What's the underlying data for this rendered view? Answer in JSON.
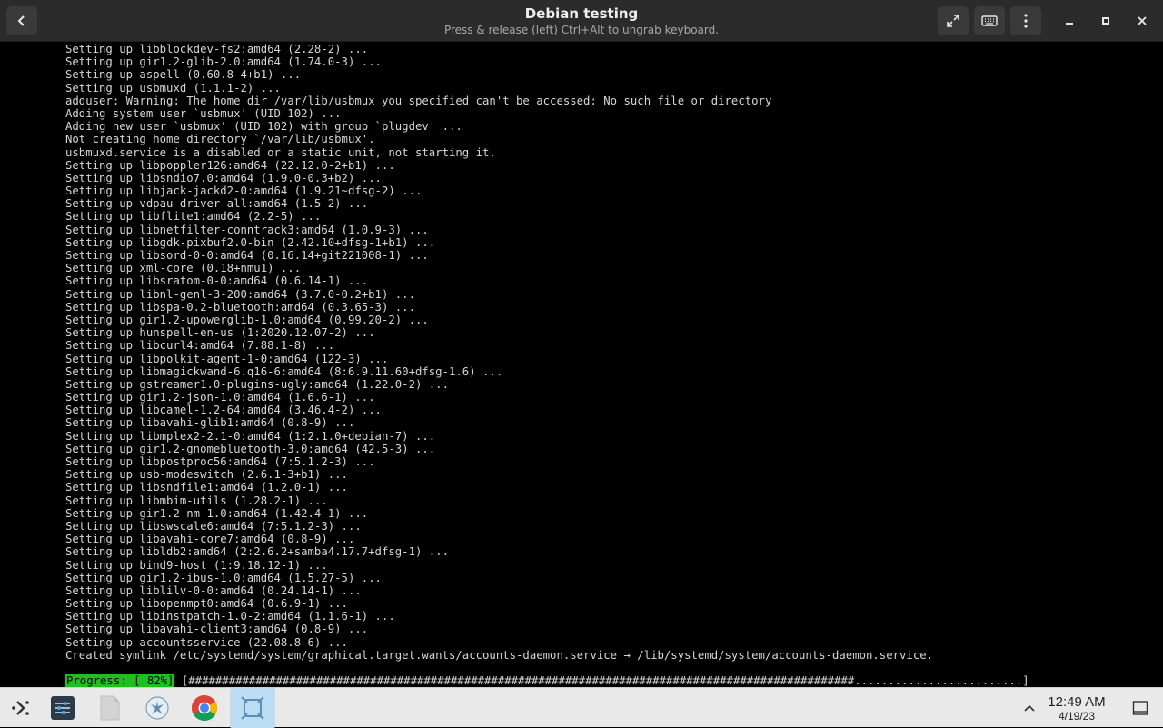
{
  "window": {
    "title": "Debian testing",
    "subtitle": "Press & release (left) Ctrl+Alt to ungrab keyboard."
  },
  "icons": {
    "back": "back-arrow-icon",
    "fullscreen": "fullscreen-icon",
    "keyboard": "keyboard-icon",
    "menu": "kebab-menu-icon",
    "minimize": "minimize-icon",
    "maximize": "maximize-icon",
    "close": "close-icon"
  },
  "terminal": {
    "lines": [
      "Setting up libblockdev-fs2:amd64 (2.28-2) ...",
      "Setting up gir1.2-glib-2.0:amd64 (1.74.0-3) ...",
      "Setting up aspell (0.60.8-4+b1) ...",
      "Setting up usbmuxd (1.1.1-2) ...",
      "adduser: Warning: The home dir /var/lib/usbmux you specified can't be accessed: No such file or directory",
      "Adding system user `usbmux' (UID 102) ...",
      "Adding new user `usbmux' (UID 102) with group `plugdev' ...",
      "Not creating home directory `/var/lib/usbmux'.",
      "usbmuxd.service is a disabled or a static unit, not starting it.",
      "Setting up libpoppler126:amd64 (22.12.0-2+b1) ...",
      "Setting up libsndio7.0:amd64 (1.9.0-0.3+b2) ...",
      "Setting up libjack-jackd2-0:amd64 (1.9.21~dfsg-2) ...",
      "Setting up vdpau-driver-all:amd64 (1.5-2) ...",
      "Setting up libflite1:amd64 (2.2-5) ...",
      "Setting up libnetfilter-conntrack3:amd64 (1.0.9-3) ...",
      "Setting up libgdk-pixbuf2.0-bin (2.42.10+dfsg-1+b1) ...",
      "Setting up libsord-0-0:amd64 (0.16.14+git221008-1) ...",
      "Setting up xml-core (0.18+nmu1) ...",
      "Setting up libsratom-0-0:amd64 (0.6.14-1) ...",
      "Setting up libnl-genl-3-200:amd64 (3.7.0-0.2+b1) ...",
      "Setting up libspa-0.2-bluetooth:amd64 (0.3.65-3) ...",
      "Setting up gir1.2-upowerglib-1.0:amd64 (0.99.20-2) ...",
      "Setting up hunspell-en-us (1:2020.12.07-2) ...",
      "Setting up libcurl4:amd64 (7.88.1-8) ...",
      "Setting up libpolkit-agent-1-0:amd64 (122-3) ...",
      "Setting up libmagickwand-6.q16-6:amd64 (8:6.9.11.60+dfsg-1.6) ...",
      "Setting up gstreamer1.0-plugins-ugly:amd64 (1.22.0-2) ...",
      "Setting up gir1.2-json-1.0:amd64 (1.6.6-1) ...",
      "Setting up libcamel-1.2-64:amd64 (3.46.4-2) ...",
      "Setting up libavahi-glib1:amd64 (0.8-9) ...",
      "Setting up libmplex2-2.1-0:amd64 (1:2.1.0+debian-7) ...",
      "Setting up gir1.2-gnomebluetooth-3.0:amd64 (42.5-3) ...",
      "Setting up libpostproc56:amd64 (7:5.1.2-3) ...",
      "Setting up usb-modeswitch (2.6.1-3+b1) ...",
      "Setting up libsndfile1:amd64 (1.2.0-1) ...",
      "Setting up libmbim-utils (1.28.2-1) ...",
      "Setting up gir1.2-nm-1.0:amd64 (1.42.4-1) ...",
      "Setting up libswscale6:amd64 (7:5.1.2-3) ...",
      "Setting up libavahi-core7:amd64 (0.8-9) ...",
      "Setting up libldb2:amd64 (2:2.6.2+samba4.17.7+dfsg-1) ...",
      "Setting up bind9-host (1:9.18.12-1) ...",
      "Setting up gir1.2-ibus-1.0:amd64 (1.5.27-5) ...",
      "Setting up liblilv-0-0:amd64 (0.24.14-1) ...",
      "Setting up libopenmpt0:amd64 (0.6.9-1) ...",
      "Setting up libinstpatch-1.0-2:amd64 (1.1.6-1) ...",
      "Setting up libavahi-client3:amd64 (0.8-9) ...",
      "Setting up accountsservice (22.08.8-6) ...",
      "Created symlink /etc/systemd/system/graphical.target.wants/accounts-daemon.service → /lib/systemd/system/accounts-daemon.service."
    ],
    "progress_label": "Progress: [ 82%]",
    "progress_bar": "[###################################################################################################.........................]",
    "progress_value": 0.82
  },
  "taskbar": {
    "items": [
      {
        "name": "app-launcher-icon"
      },
      {
        "name": "settings-sliders-icon"
      },
      {
        "name": "file-icon"
      },
      {
        "name": "plasma-discover-icon"
      },
      {
        "name": "chrome-icon"
      },
      {
        "name": "vm-window-icon"
      }
    ],
    "time": "12:49 AM",
    "date": "4/19/23",
    "tray_expand_icon": "chevron-up-icon",
    "show_desktop_icon": "show-desktop-icon",
    "colors": {
      "active_highlight": "#bcdcf4",
      "progress_green": "#1fbf1f"
    }
  }
}
